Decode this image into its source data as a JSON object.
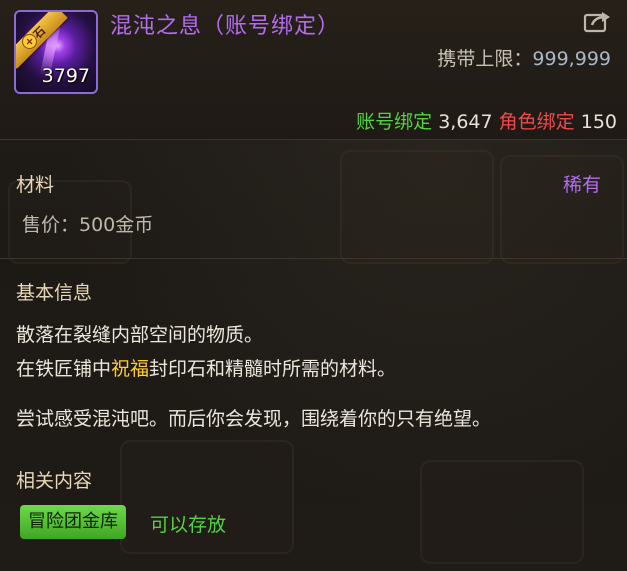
{
  "item": {
    "name": "混沌之息（账号绑定）",
    "ribbon": "碎石",
    "count": "3797",
    "carry_limit_label": "携带上限：",
    "carry_limit_value": "999,999"
  },
  "binding": {
    "account_label": "账号绑定",
    "account_value": "3,647",
    "role_label": "角色绑定",
    "role_value": "150"
  },
  "category": {
    "type": "材料",
    "rarity": "稀有",
    "price": "售价：500金币"
  },
  "basic_info": {
    "title": "基本信息",
    "line1": "散落在裂缝内部空间的物质。",
    "line2_prefix": "在铁匠铺中",
    "line2_highlight": "祝福",
    "line2_suffix": "封印石和精髓时所需的材料。",
    "line3": "尝试感受混沌吧。而后你会发现，围绕着你的只有绝望。"
  },
  "related": {
    "title": "相关内容",
    "badge": "冒险团金库",
    "note": "可以存放"
  },
  "colors": {
    "epic_purple": "#b36cf0",
    "account_bind_green": "#52d43e",
    "role_bind_red": "#f04a4a",
    "highlight_gold": "#ffcc33"
  },
  "icons": {
    "share": "share-export-icon",
    "item": "chaos-breath-item-icon"
  }
}
